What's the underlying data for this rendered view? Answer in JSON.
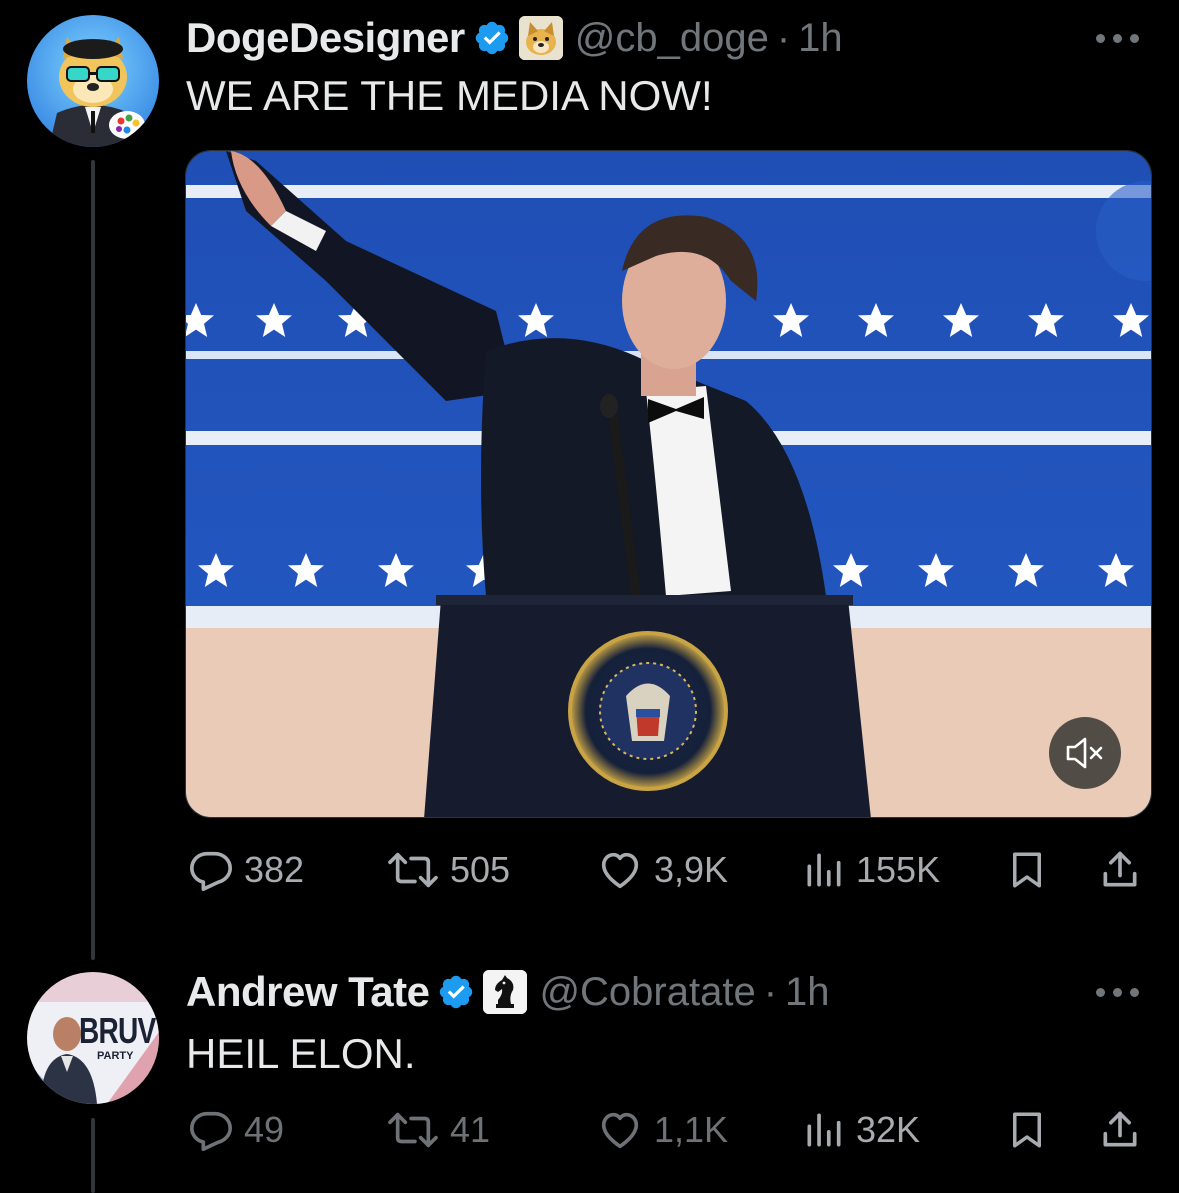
{
  "tweets": [
    {
      "author": {
        "display_name": "DogeDesigner",
        "handle": "@cb_doge",
        "verified": true,
        "affiliation_icon": "doge-face-icon",
        "avatar_icon": "doge-artist-avatar"
      },
      "separator": "·",
      "time": "1h",
      "text": "WE ARE THE MEDIA NOW!",
      "media": {
        "type": "video",
        "muted": true,
        "seal_text": "SEAL OF THE PRESIDENT OF THE UNITED STATES"
      },
      "stats": {
        "replies": "382",
        "reposts": "505",
        "likes": "3,9K",
        "views": "155K"
      }
    },
    {
      "author": {
        "display_name": "Andrew Tate",
        "handle": "@Cobratate",
        "verified": true,
        "affiliation_icon": "chess-knight-icon",
        "avatar_icon": "bruv-party-avatar",
        "avatar_text": "BRUV",
        "avatar_subtext": "PARTY"
      },
      "separator": "·",
      "time": "1h",
      "text": "HEIL ELON.",
      "stats": {
        "replies": "49",
        "reposts": "41",
        "likes": "1,1K",
        "views": "32K"
      }
    }
  ],
  "colors": {
    "background": "#000000",
    "text": "#e7e9ea",
    "secondary": "#71767b",
    "verified": "#1d9bf0",
    "thread_line": "#333639"
  }
}
